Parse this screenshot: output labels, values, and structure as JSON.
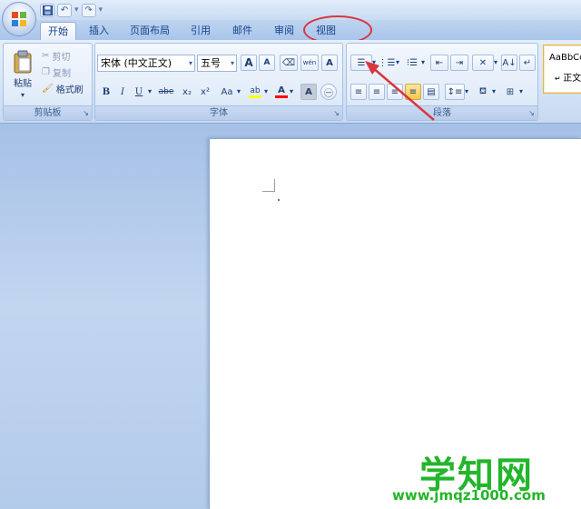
{
  "tabs": [
    "开始",
    "插入",
    "页面布局",
    "引用",
    "邮件",
    "审阅",
    "视图"
  ],
  "active_tab": "开始",
  "clipboard": {
    "paste_label": "粘贴",
    "cut_label": "剪切",
    "copy_label": "复制",
    "format_painter_label": "格式刷",
    "group_label": "剪贴板"
  },
  "font": {
    "font_name": "宋体 (中文正文)",
    "font_size": "五号",
    "group_label": "字体",
    "bold": "B",
    "italic": "I",
    "underline": "U",
    "strike": "abe",
    "subscript": "x₂",
    "superscript": "x²",
    "change_case": "Aa",
    "grow": "A",
    "shrink": "A",
    "phonetic": "wén",
    "highlight_color": "#ffff00",
    "font_color": "#ff0000"
  },
  "paragraph": {
    "group_label": "段落"
  },
  "styles": {
    "sample": "AaBbCc",
    "name": "正文"
  },
  "watermark": {
    "brand": "学知网",
    "url": "www.jmqz1000.com"
  },
  "colors": {
    "accent_red": "#d9363e",
    "watermark_green": "#23b52a"
  }
}
